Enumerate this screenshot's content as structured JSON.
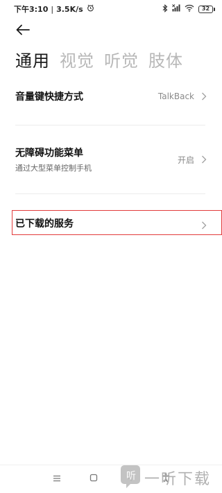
{
  "status_bar": {
    "time": "下午3:10",
    "separator": "|",
    "net_speed": "3.5K/s",
    "battery": "32"
  },
  "tabs": [
    {
      "label": "通用",
      "active": true
    },
    {
      "label": "视觉",
      "active": false
    },
    {
      "label": "听觉",
      "active": false
    },
    {
      "label": "肢体",
      "active": false
    }
  ],
  "rows": {
    "volume_shortcut": {
      "title": "音量键快捷方式",
      "value": "TalkBack"
    },
    "accessibility_menu": {
      "title": "无障碍功能菜单",
      "subtitle": "通过大型菜单控制手机",
      "value": "开启"
    },
    "downloaded_services": {
      "title": "已下载的服务"
    }
  },
  "watermark": {
    "text": "一听下载"
  },
  "colors": {
    "highlight": "#e23b3b",
    "inactive_tab": "#b8b8b8"
  }
}
